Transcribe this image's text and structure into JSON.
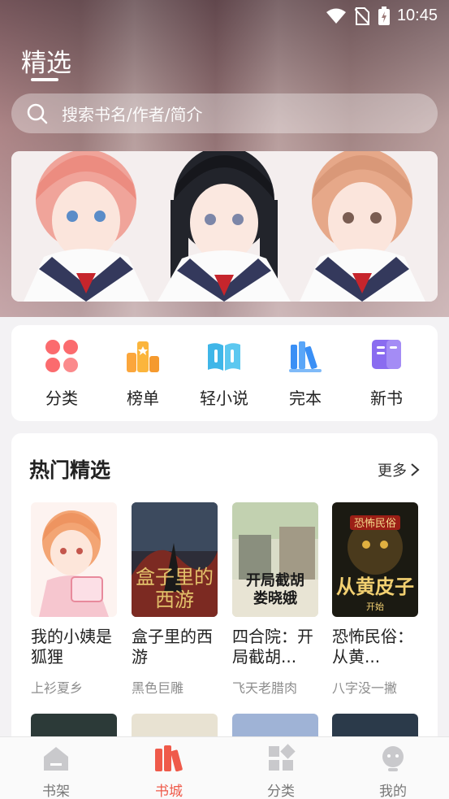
{
  "status_bar": {
    "time": "10:45"
  },
  "header": {
    "title": "精选"
  },
  "search": {
    "placeholder": "搜索书名/作者/简介"
  },
  "quick_entries": [
    {
      "label": "分类",
      "icon": "grid-icon"
    },
    {
      "label": "榜单",
      "icon": "ranking-icon"
    },
    {
      "label": "轻小说",
      "icon": "open-book-icon"
    },
    {
      "label": "完本",
      "icon": "bookshelf-icon"
    },
    {
      "label": "新书",
      "icon": "new-book-icon"
    }
  ],
  "hot_section": {
    "title": "热门精选",
    "more_label": "更多",
    "books": [
      {
        "title": "我的小姨是狐狸",
        "author": "上衫夏乡"
      },
      {
        "title": "盒子里的西游",
        "author": "黑色巨雕"
      },
      {
        "title": "四合院：开局截胡...",
        "author": "飞天老腊肉"
      },
      {
        "title": "恐怖民俗：从黄...",
        "author": "八字没一撇"
      }
    ]
  },
  "bottom_nav": [
    {
      "label": "书架",
      "icon": "bookshelf-home-icon",
      "active": false
    },
    {
      "label": "书城",
      "icon": "bookstore-icon",
      "active": true
    },
    {
      "label": "分类",
      "icon": "category-icon",
      "active": false
    },
    {
      "label": "我的",
      "icon": "profile-icon",
      "active": false
    }
  ],
  "colors": {
    "accent": "#ef5a4a",
    "text": "#222222",
    "muted": "#8d8d8d"
  }
}
